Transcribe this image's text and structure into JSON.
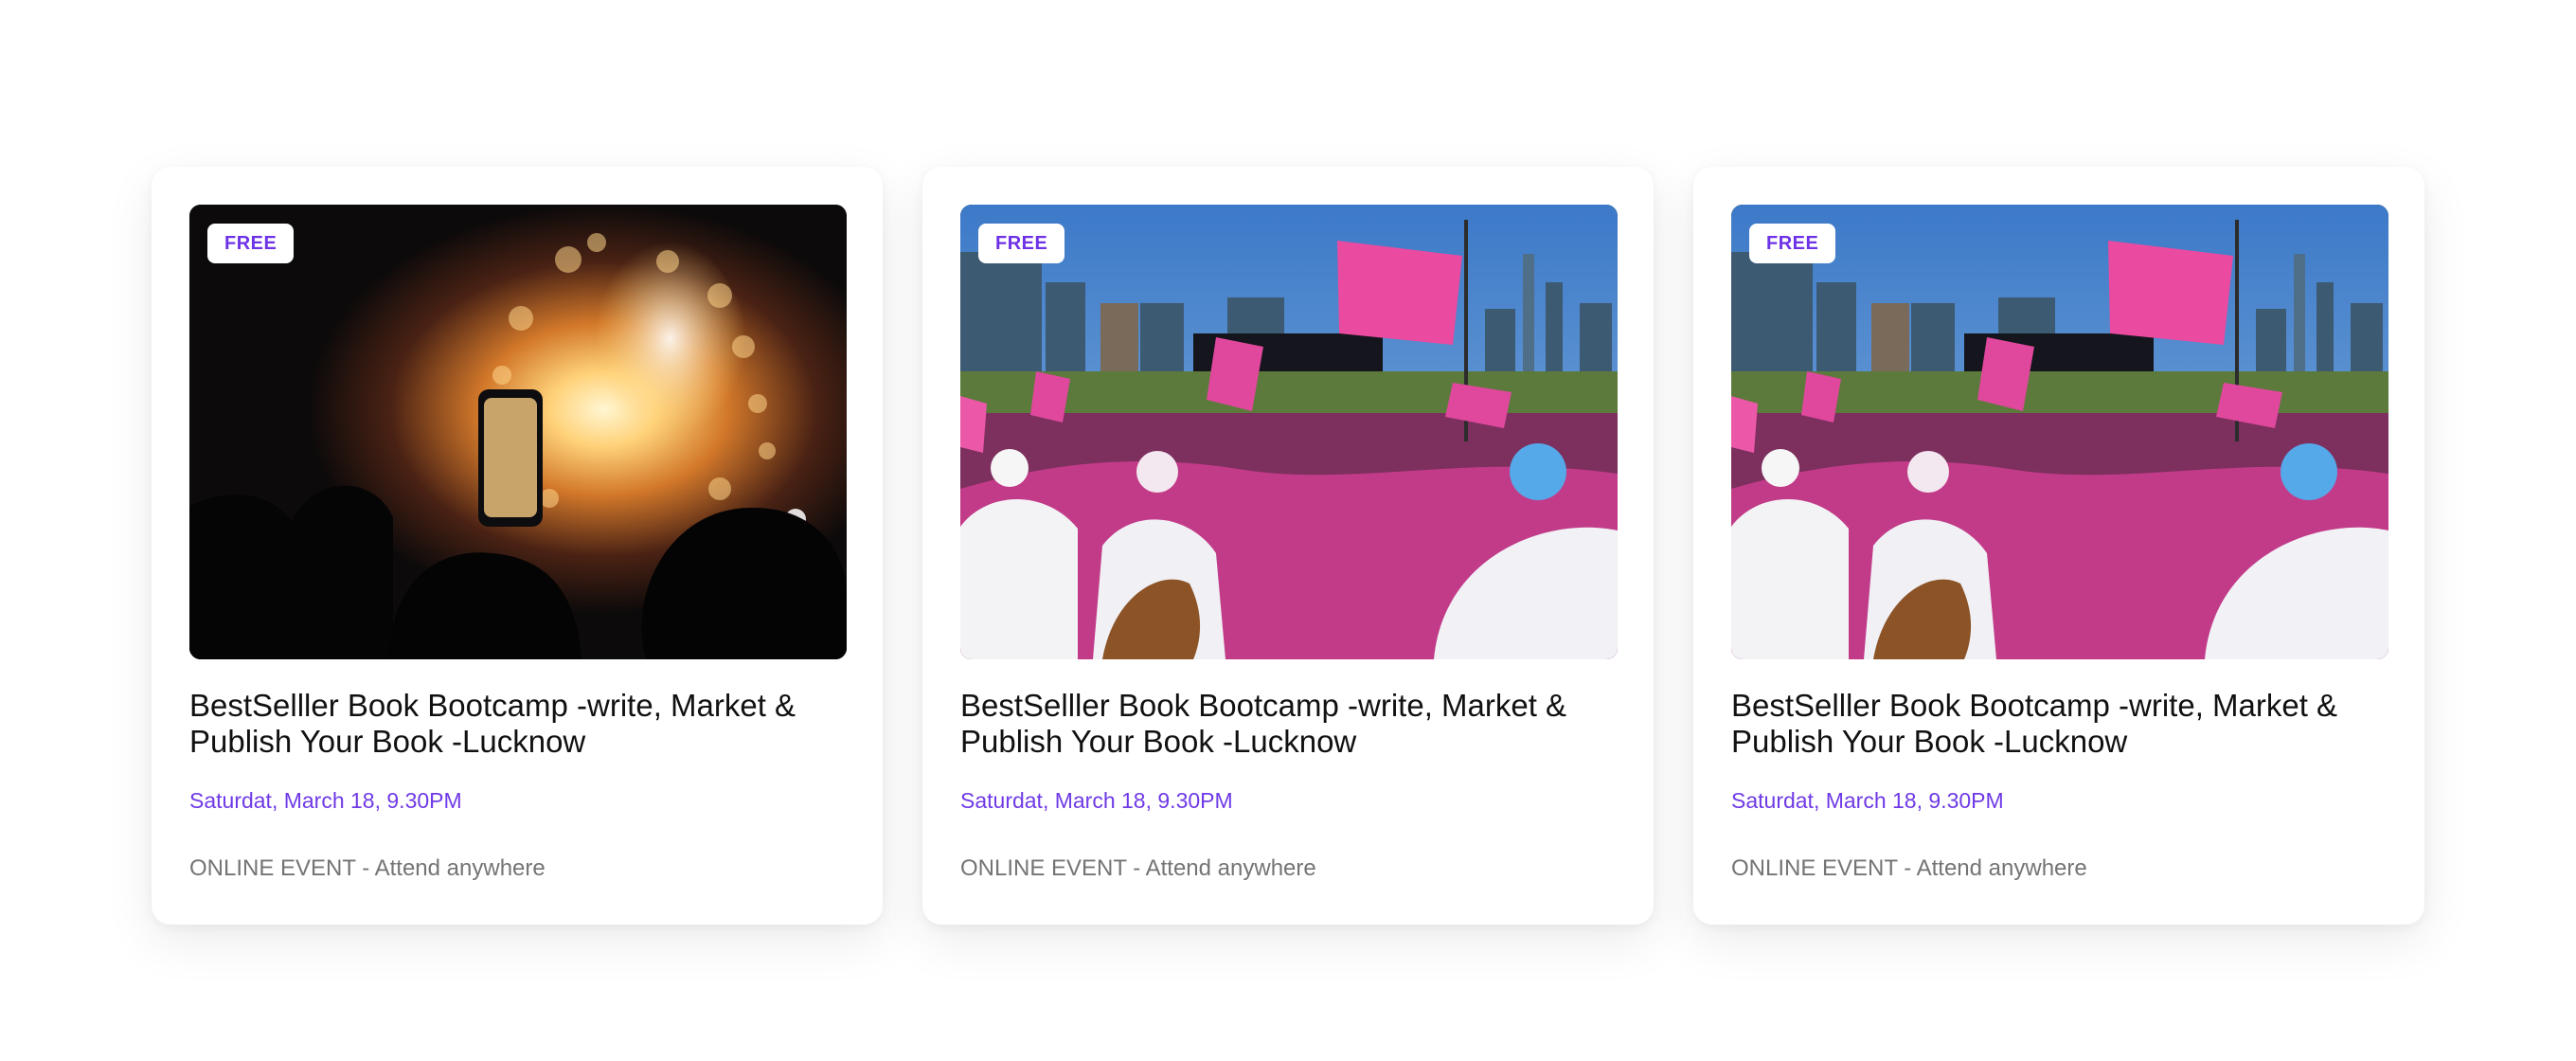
{
  "cards": [
    {
      "badge": "FREE",
      "title": "BestSelller Book Bootcamp -write, Market & Publish Your Book -Lucknow",
      "date": "Saturdat, March 18, 9.30PM",
      "location": "ONLINE EVENT - Attend anywhere",
      "image_label": "fireworks-concert-photo"
    },
    {
      "badge": "FREE",
      "title": "BestSelller Book Bootcamp -write, Market & Publish Your Book -Lucknow",
      "date": "Saturdat, March 18, 9.30PM",
      "location": "ONLINE EVENT - Attend anywhere",
      "image_label": "pink-rally-crowd-photo"
    },
    {
      "badge": "FREE",
      "title": "BestSelller Book Bootcamp -write, Market & Publish Your Book -Lucknow",
      "date": "Saturdat, March 18, 9.30PM",
      "location": "ONLINE EVENT - Attend anywhere",
      "image_label": "pink-rally-crowd-photo"
    }
  ],
  "colors": {
    "accent": "#6f3ae6",
    "muted": "#747474",
    "title": "#111111"
  }
}
